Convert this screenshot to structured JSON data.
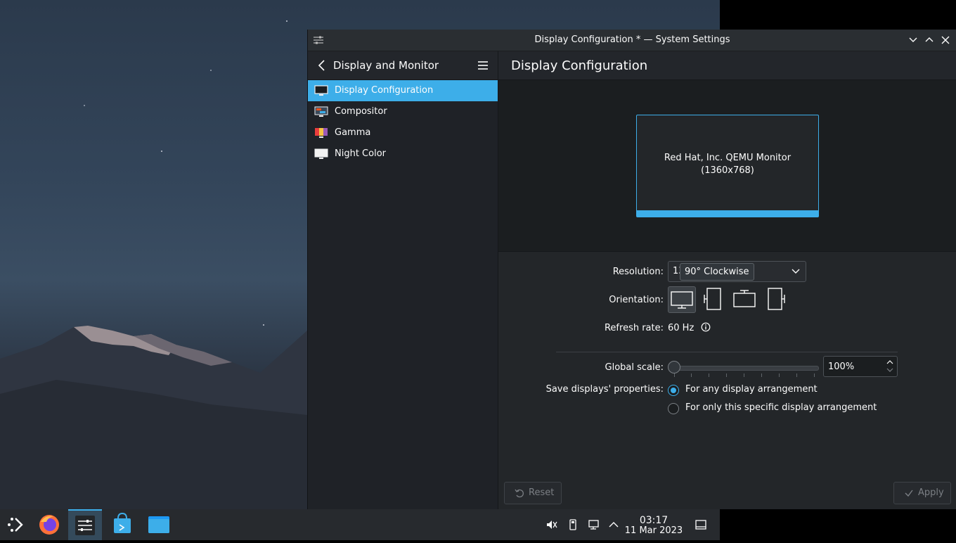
{
  "window": {
    "title": "Display Configuration * — System Settings"
  },
  "sidebar": {
    "header_label": "Display and Monitor",
    "items": [
      {
        "label": "Display Configuration",
        "icon": "monitor-icon",
        "active": true
      },
      {
        "label": "Compositor",
        "icon": "compositor-icon",
        "active": false
      },
      {
        "label": "Gamma",
        "icon": "gamma-icon",
        "active": false
      },
      {
        "label": "Night Color",
        "icon": "night-color-icon",
        "active": false
      }
    ]
  },
  "main": {
    "title": "Display Configuration",
    "monitor_name": "Red Hat, Inc. QEMU Monitor",
    "monitor_res": "(1360x768)",
    "resolution_label": "Resolution:",
    "resolution_value": "13",
    "orientation_tooltip": "90° Clockwise",
    "orientation_label": "Orientation:",
    "refresh_label": "Refresh rate:",
    "refresh_value": "60 Hz",
    "scale_label": "Global scale:",
    "scale_value": "100%",
    "save_label": "Save displays' properties:",
    "save_options": [
      "For any display arrangement",
      "For only this specific display arrangement"
    ],
    "save_selected": 0,
    "reset_label": "Reset",
    "apply_label": "Apply"
  },
  "taskbar": {
    "time": "03:17",
    "date": "11 Mar 2023"
  },
  "colors": {
    "accent": "#3daee9",
    "window_bg": "#232629",
    "taskbar_bg": "#272a2e"
  }
}
